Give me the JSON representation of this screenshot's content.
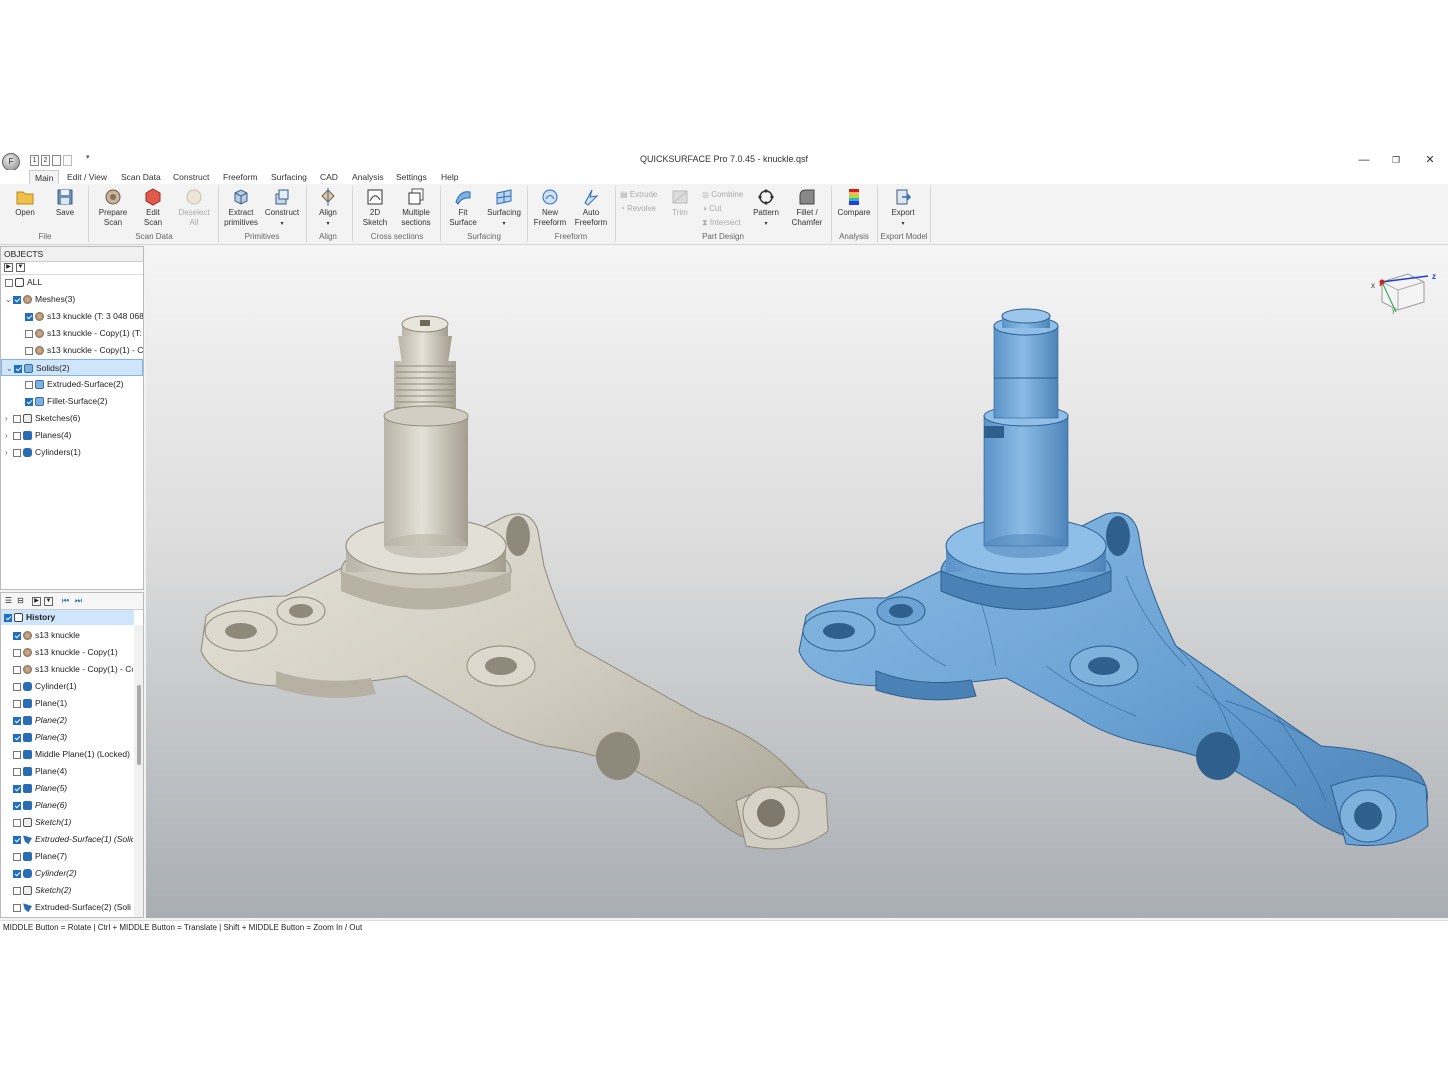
{
  "window": {
    "title": "QUICKSURFACE Pro 7.0.45 - knuckle.qsf",
    "quick_access": [
      "1",
      "2"
    ],
    "logo_letter": "F"
  },
  "menu": [
    "Main",
    "Edit / View",
    "Scan Data",
    "Construct",
    "Freeform",
    "Surfacing",
    "CAD",
    "Analysis",
    "Settings",
    "Help"
  ],
  "ribbon": {
    "open": "Open",
    "save": "Save",
    "group_file": "File",
    "prepare_scan": [
      "Prepare",
      "Scan"
    ],
    "edit_scan": [
      "Edit",
      "Scan"
    ],
    "deselect_all": [
      "Deselect",
      "All"
    ],
    "group_scan_data": "Scan Data",
    "extract_primitives": [
      "Extract",
      "primitives"
    ],
    "construct": "Construct",
    "group_primitives": "Primitives",
    "align": "Align",
    "group_align": "Align",
    "sketch_2d": [
      "2D",
      "Sketch"
    ],
    "multiple_sections": [
      "Multiple",
      "sections"
    ],
    "group_cross_sections": "Cross sections",
    "fit_surface": [
      "Fit",
      "Surface"
    ],
    "surfacing": "Surfacing",
    "group_surfacing": "Surfacing",
    "new_freeform": [
      "New",
      "Freeform"
    ],
    "auto_freeform": [
      "Auto",
      "Freeform"
    ],
    "group_freeform": "Freeform",
    "extrude": "Extrude",
    "revolve": "Revolve",
    "trim": "Trim",
    "combine": "Combine",
    "cut": "Cut",
    "intersect": "Intersect",
    "pattern": "Pattern",
    "fillet_chamfer": [
      "Fillet /",
      "Chamfer"
    ],
    "group_part_design": "Part Design",
    "compare": "Compare",
    "group_analysis": "Analysis",
    "export": "Export",
    "group_export_model": "Export Model"
  },
  "objects": {
    "header": "OBJECTS",
    "rows": [
      {
        "label": "ALL",
        "checked": false,
        "indent": 0,
        "icon": "list-icon"
      },
      {
        "label": "Meshes(3)",
        "checked": true,
        "indent": 1,
        "icon": "mesh-icon",
        "expander": "v"
      },
      {
        "label": "s13 knuckle (T: 3 048 068)",
        "checked": true,
        "indent": 2,
        "icon": "mesh-icon"
      },
      {
        "label": "s13 knuckle - Copy(1) (T:",
        "checked": false,
        "indent": 2,
        "icon": "mesh-icon"
      },
      {
        "label": "s13 knuckle - Copy(1) - C",
        "checked": false,
        "indent": 2,
        "icon": "mesh-icon"
      },
      {
        "label": "Solids(2)",
        "checked": true,
        "indent": 1,
        "icon": "solid-icon",
        "expander": "v",
        "selected": true
      },
      {
        "label": "Extruded-Surface(2)",
        "checked": false,
        "indent": 2,
        "icon": "solid-icon"
      },
      {
        "label": "Fillet-Surface(2)",
        "checked": true,
        "indent": 2,
        "icon": "solid-icon"
      },
      {
        "label": "Sketches(6)",
        "checked": false,
        "indent": 1,
        "icon": "sketch-icon",
        "expander": ">"
      },
      {
        "label": "Planes(4)",
        "checked": false,
        "indent": 1,
        "icon": "plane-icon",
        "expander": ">"
      },
      {
        "label": "Cylinders(1)",
        "checked": false,
        "indent": 1,
        "icon": "cylinder-icon",
        "expander": ">"
      }
    ]
  },
  "history": {
    "header": "History",
    "rows": [
      {
        "label": "s13 knuckle",
        "checked": true,
        "icon": "mesh-icon"
      },
      {
        "label": "s13 knuckle - Copy(1)",
        "checked": false,
        "icon": "mesh-icon"
      },
      {
        "label": "s13 knuckle - Copy(1) - Cc",
        "checked": false,
        "icon": "mesh-icon"
      },
      {
        "label": "Cylinder(1)",
        "checked": false,
        "icon": "cylinder-icon"
      },
      {
        "label": "Plane(1)",
        "checked": false,
        "icon": "plane-icon"
      },
      {
        "label": "Plane(2)",
        "checked": true,
        "icon": "plane-icon",
        "italic": true
      },
      {
        "label": "Plane(3)",
        "checked": true,
        "icon": "plane-icon",
        "italic": true
      },
      {
        "label": "Middle Plane(1) (Locked)",
        "checked": false,
        "icon": "plane-icon"
      },
      {
        "label": "Plane(4)",
        "checked": false,
        "icon": "plane-icon"
      },
      {
        "label": "Plane(5)",
        "checked": true,
        "icon": "plane-icon",
        "italic": true
      },
      {
        "label": "Plane(6)",
        "checked": true,
        "icon": "plane-icon",
        "italic": true
      },
      {
        "label": "Sketch(1)",
        "checked": false,
        "icon": "sketch-icon",
        "italic": true
      },
      {
        "label": "Extruded-Surface(1) (Solid,",
        "checked": true,
        "icon": "extrude-icon",
        "italic": true
      },
      {
        "label": "Plane(7)",
        "checked": false,
        "icon": "plane-icon"
      },
      {
        "label": "Cylinder(2)",
        "checked": true,
        "icon": "cylinder-icon",
        "italic": true
      },
      {
        "label": "Sketch(2)",
        "checked": false,
        "icon": "sketch-icon",
        "italic": true
      },
      {
        "label": "Extruded-Surface(2) (Soli",
        "checked": false,
        "icon": "extrude-icon"
      }
    ]
  },
  "viewport": {
    "axes": {
      "x": "x",
      "y": "y",
      "z": "z"
    },
    "scan_color": "#d3cfc4",
    "cad_color": "#6aa2d4"
  },
  "status": "MIDDLE Button = Rotate | Ctrl + MIDDLE Button = Translate | Shift + MIDDLE Button = Zoom In / Out"
}
